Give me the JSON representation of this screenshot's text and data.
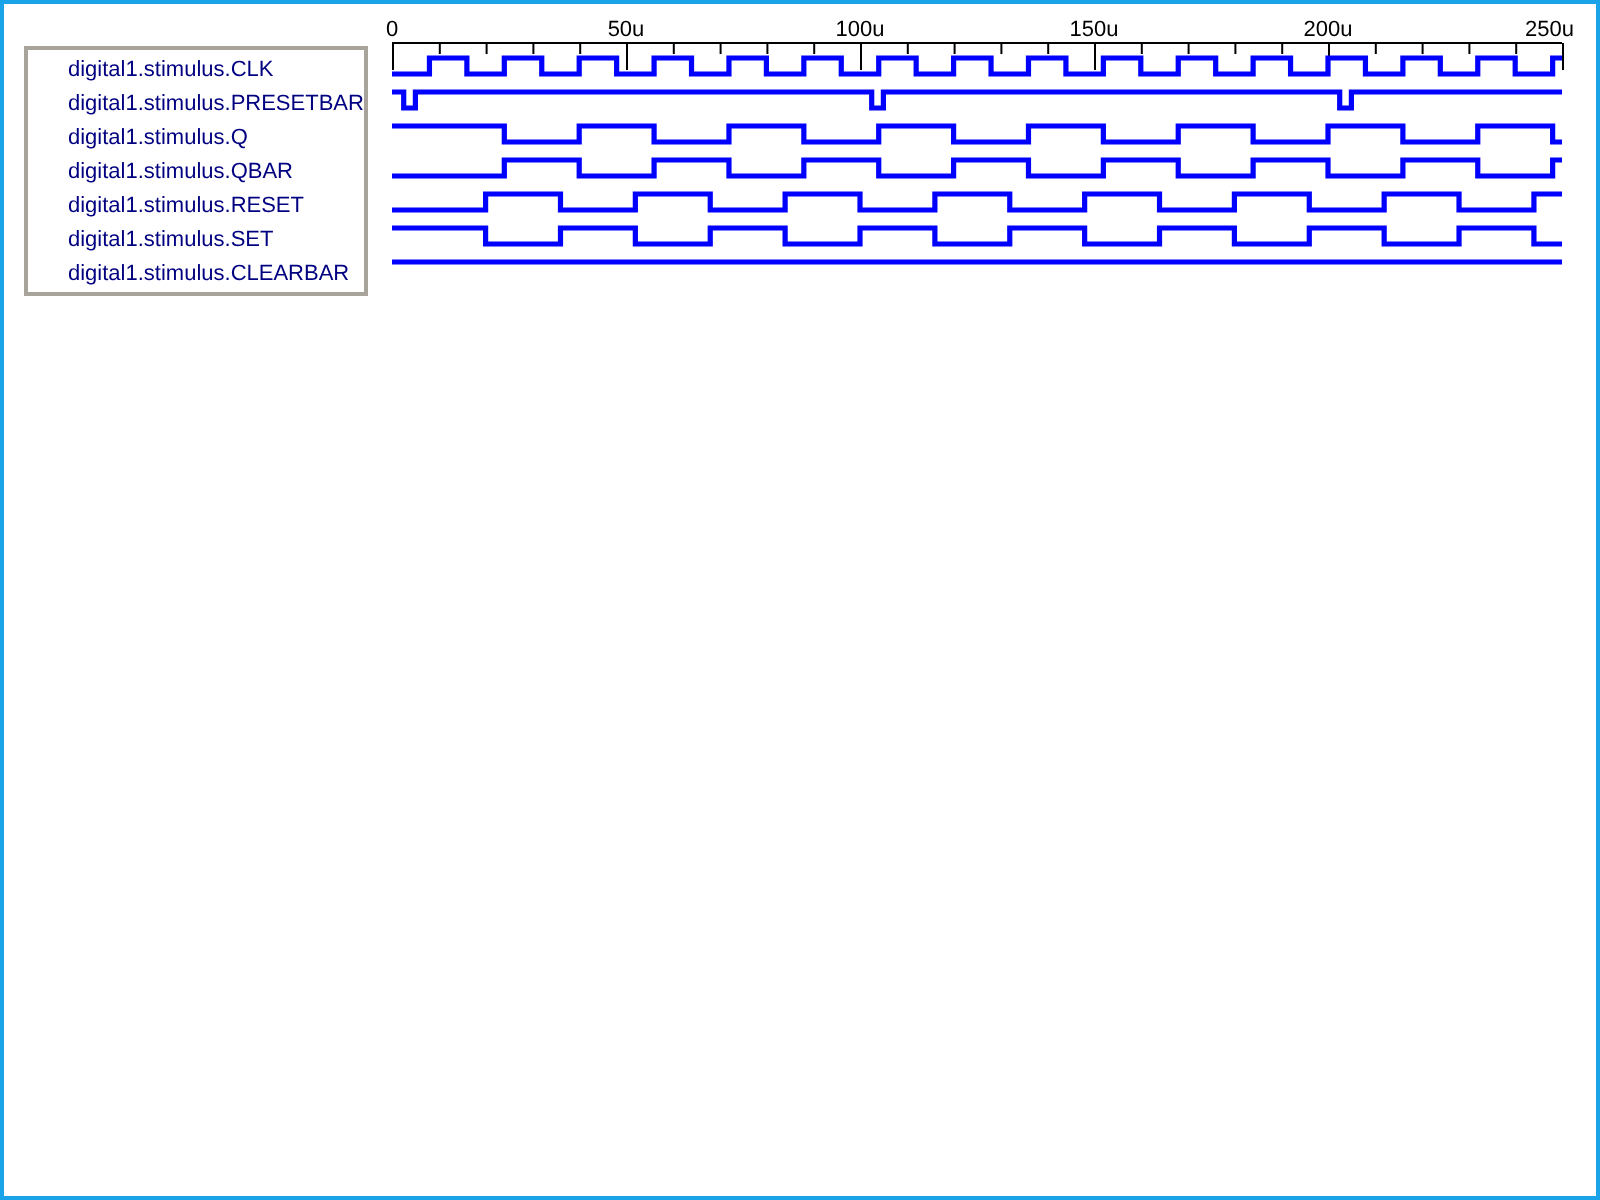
{
  "time_axis": {
    "ticks": [
      {
        "label": "0"
      },
      {
        "label": "50u"
      },
      {
        "label": "100u"
      },
      {
        "label": "150u"
      },
      {
        "label": "200u"
      },
      {
        "label": "250u"
      }
    ]
  },
  "signals": [
    {
      "name": "digital1.stimulus.CLK"
    },
    {
      "name": "digital1.stimulus.PRESETBAR"
    },
    {
      "name": "digital1.stimulus.Q"
    },
    {
      "name": "digital1.stimulus.QBAR"
    },
    {
      "name": "digital1.stimulus.RESET"
    },
    {
      "name": "digital1.stimulus.SET"
    },
    {
      "name": "digital1.stimulus.CLEARBAR"
    }
  ]
}
